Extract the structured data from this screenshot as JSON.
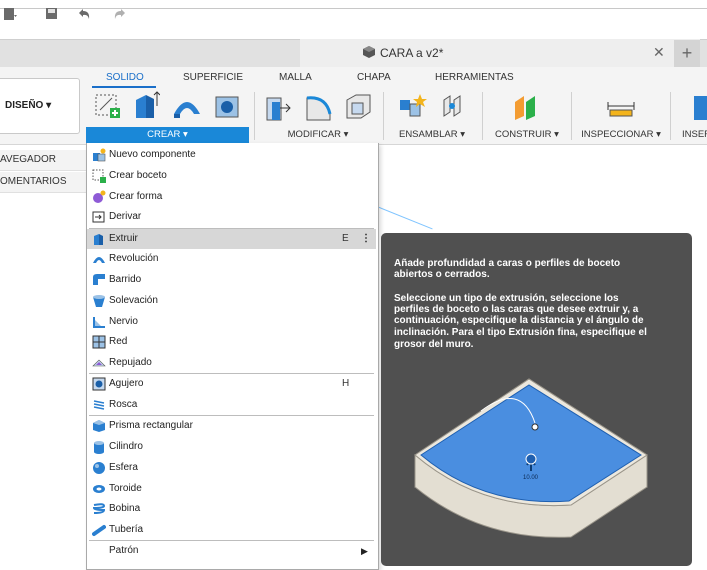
{
  "window": {
    "document_title": "CARA a v2*"
  },
  "ribbon": {
    "tabs": [
      {
        "label": "SOLIDO",
        "active": true
      },
      {
        "label": "SUPERFICIE",
        "active": false
      },
      {
        "label": "MALLA",
        "active": false
      },
      {
        "label": "CHAPA",
        "active": false
      },
      {
        "label": "HERRAMIENTAS",
        "active": false
      }
    ],
    "workspace_label": "DISEÑO ▾",
    "groups": {
      "crear": "CREAR ▾",
      "modificar": "MODIFICAR ▾",
      "ensamblar": "ENSAMBLAR ▾",
      "construir": "CONSTRUIR ▾",
      "inspeccionar": "INSPECCIONAR ▾",
      "insertar": "INSER"
    },
    "accent_color": "#1a88d8"
  },
  "browser": {
    "items": [
      "AVEGADOR",
      "OMENTARIOS"
    ]
  },
  "create_menu": {
    "items": [
      {
        "label": "Nuevo componente",
        "shortcut": "",
        "icon": "new-component-icon"
      },
      {
        "label": "Crear boceto",
        "shortcut": "",
        "icon": "create-sketch-icon"
      },
      {
        "label": "Crear forma",
        "shortcut": "",
        "icon": "create-form-icon"
      },
      {
        "label": "Derivar",
        "shortcut": "",
        "icon": "derive-icon"
      },
      {
        "label": "Extruir",
        "shortcut": "E",
        "icon": "extrude-icon",
        "highlighted": true
      },
      {
        "label": "Revolución",
        "shortcut": "",
        "icon": "revolve-icon"
      },
      {
        "label": "Barrido",
        "shortcut": "",
        "icon": "sweep-icon"
      },
      {
        "label": "Solevación",
        "shortcut": "",
        "icon": "loft-icon"
      },
      {
        "label": "Nervio",
        "shortcut": "",
        "icon": "rib-icon"
      },
      {
        "label": "Red",
        "shortcut": "",
        "icon": "web-icon"
      },
      {
        "label": "Repujado",
        "shortcut": "",
        "icon": "emboss-icon"
      },
      {
        "label": "Agujero",
        "shortcut": "H",
        "icon": "hole-icon"
      },
      {
        "label": "Rosca",
        "shortcut": "",
        "icon": "thread-icon"
      },
      {
        "label": "Prisma rectangular",
        "shortcut": "",
        "icon": "box-icon"
      },
      {
        "label": "Cilindro",
        "shortcut": "",
        "icon": "cylinder-icon"
      },
      {
        "label": "Esfera",
        "shortcut": "",
        "icon": "sphere-icon"
      },
      {
        "label": "Toroide",
        "shortcut": "",
        "icon": "torus-icon"
      },
      {
        "label": "Bobina",
        "shortcut": "",
        "icon": "coil-icon"
      },
      {
        "label": "Tubería",
        "shortcut": "",
        "icon": "pipe-icon"
      },
      {
        "label": "Patrón",
        "shortcut": "",
        "icon": ""
      }
    ]
  },
  "tooltip": {
    "heading_lines": [
      "Añade profundidad a caras o perfiles de boceto",
      "abiertos o cerrados."
    ],
    "body_lines": [
      "Seleccione un tipo de extrusión, seleccione los",
      "perfiles de boceto o las caras que desee extruir y, a",
      "continuación, especifique la distancia y el ángulo de",
      "inclinación. Para el tipo Extrusión fina, especifique el",
      "grosor del muro."
    ],
    "preview_dimension": "10.00"
  }
}
